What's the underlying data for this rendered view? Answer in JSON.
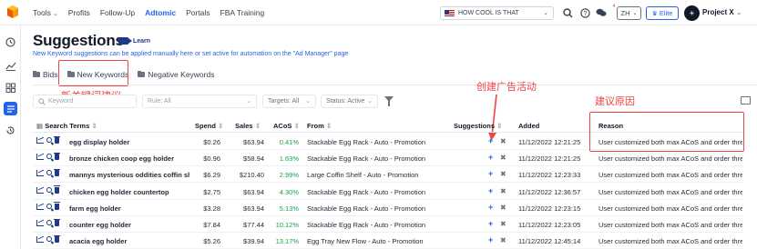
{
  "nav": {
    "items": [
      {
        "label": "Tools",
        "caret": true,
        "active": false
      },
      {
        "label": "Profits",
        "caret": false,
        "active": false
      },
      {
        "label": "Follow-Up",
        "caret": false,
        "active": false
      },
      {
        "label": "Adtomic",
        "caret": false,
        "active": true
      },
      {
        "label": "Portals",
        "caret": false,
        "active": false
      },
      {
        "label": "FBA Training",
        "caret": false,
        "active": false
      }
    ],
    "store_select": "HOW COOL IS THAT",
    "language": "ZH",
    "plan": "Elite",
    "project": "Project X",
    "notification_count": "4"
  },
  "page": {
    "title": "Suggestions",
    "learn_label": "Learn",
    "subtitle": "New Keyword suggestions can be applied manually here or set active for automation on the \"Ad Manager\" page"
  },
  "tabs": [
    {
      "label": "Bids",
      "active": false
    },
    {
      "label": "New Keywords",
      "active": true
    },
    {
      "label": "Negative Keywords",
      "active": false
    }
  ],
  "annotations": {
    "new_keyword_suggestion": "新关键词建议",
    "create_campaign": "创建广告活动",
    "reason_suggestion": "建议原因"
  },
  "filters": {
    "keyword_placeholder": "Keyword",
    "rule": "Rule: All",
    "targets": "Targets: All",
    "status": "Status: Active"
  },
  "table": {
    "headers": {
      "search_terms": "Search Terms",
      "spend": "Spend",
      "sales": "Sales",
      "acos": "ACoS",
      "from": "From",
      "suggestions": "Suggestions",
      "added": "Added",
      "reason": "Reason"
    },
    "rows": [
      {
        "term": "egg display holder",
        "spend": "$0.26",
        "sales": "$63.94",
        "acos": "0.41%",
        "from": "Stackable Egg Rack - Auto - Promotion",
        "added": "11/12/2022 12:21:25",
        "reason": "User customized both max ACoS and order thre..."
      },
      {
        "term": "bronze chicken coop egg holder",
        "spend": "$0.96",
        "sales": "$58.94",
        "acos": "1.63%",
        "from": "Stackable Egg Rack - Auto - Promotion",
        "added": "11/12/2022 12:21:25",
        "reason": "User customized both max ACoS and order thre..."
      },
      {
        "term": "mannys mysterious oddities coffin sh...",
        "spend": "$6.29",
        "sales": "$210.40",
        "acos": "2.99%",
        "from": "Large Coffin Shelf - Auto - Promotion",
        "added": "11/12/2022 12:23:33",
        "reason": "User customized both max ACoS and order thre..."
      },
      {
        "term": "chicken egg holder countertop",
        "spend": "$2.75",
        "sales": "$63.94",
        "acos": "4.30%",
        "from": "Stackable Egg Rack - Auto - Promotion",
        "added": "11/12/2022 12:36:57",
        "reason": "User customized both max ACoS and order thre..."
      },
      {
        "term": "farm egg holder",
        "spend": "$3.28",
        "sales": "$63.94",
        "acos": "5.13%",
        "from": "Stackable Egg Rack - Auto - Promotion",
        "added": "11/12/2022 12:23:15",
        "reason": "User customized both max ACoS and order thre..."
      },
      {
        "term": "counter egg holder",
        "spend": "$7.84",
        "sales": "$77.44",
        "acos": "10.12%",
        "from": "Stackable Egg Rack - Auto - Promotion",
        "added": "11/12/2022 12:23:05",
        "reason": "User customized both max ACoS and order thre..."
      },
      {
        "term": "acacia egg holder",
        "spend": "$5.26",
        "sales": "$39.94",
        "acos": "13.17%",
        "from": "Egg Tray New Flow - Auto - Promotion",
        "added": "11/12/2022 12:45:14",
        "reason": "User customized both max ACoS and order thre..."
      }
    ]
  },
  "colors": {
    "accent": "#2563eb",
    "annotation": "#ef4444",
    "acos_good": "#16a34a"
  }
}
